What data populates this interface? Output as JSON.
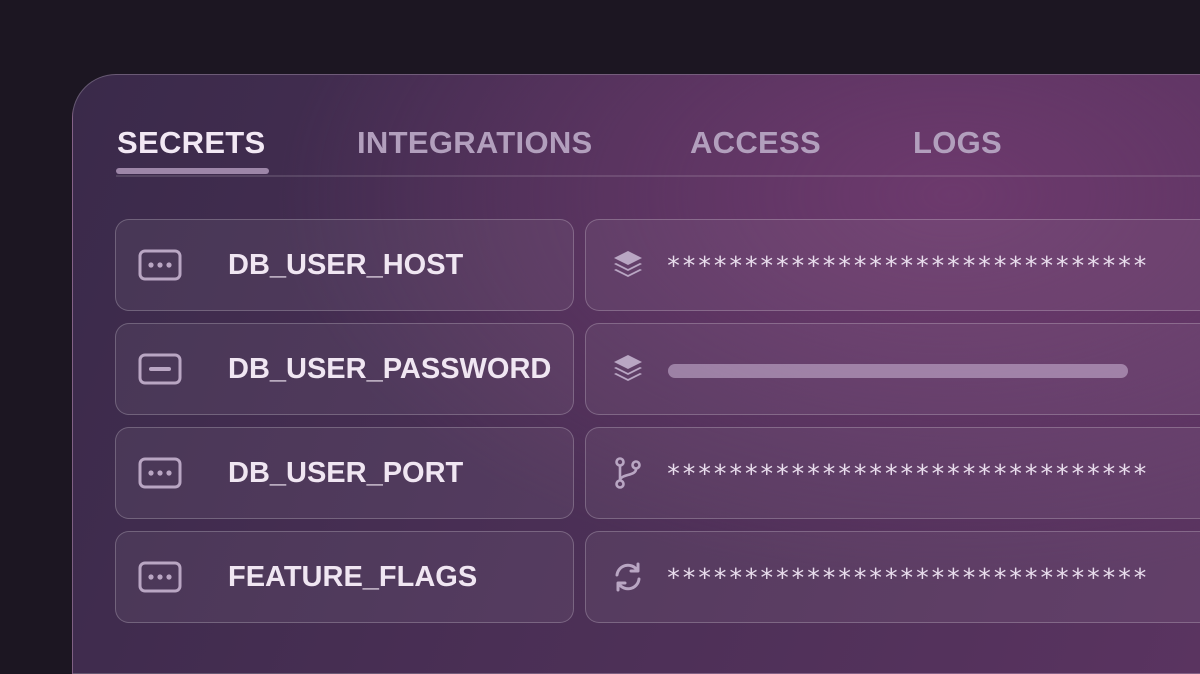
{
  "tabs": [
    {
      "label": "SECRETS",
      "active": true
    },
    {
      "label": "INTEGRATIONS",
      "active": false
    },
    {
      "label": "ACCESS",
      "active": false
    },
    {
      "label": "LOGS",
      "active": false
    }
  ],
  "secrets": [
    {
      "key": "DB_USER_HOST",
      "key_icon": "ellipsis-box-icon",
      "value_icon": "layers-icon",
      "value": "*******************************",
      "masked_bar": false
    },
    {
      "key": "DB_USER_PASSWORD",
      "key_icon": "minus-box-icon",
      "value_icon": "layers-icon",
      "value": "",
      "masked_bar": true
    },
    {
      "key": "DB_USER_PORT",
      "key_icon": "ellipsis-box-icon",
      "value_icon": "git-branch-icon",
      "value": "*******************************",
      "masked_bar": false
    },
    {
      "key": "FEATURE_FLAGS",
      "key_icon": "ellipsis-box-icon",
      "value_icon": "refresh-icon",
      "value": "*******************************",
      "masked_bar": false
    }
  ],
  "colors": {
    "background": "#1c1622",
    "accent": "#9d86a8",
    "text": "#f0e6f2"
  }
}
